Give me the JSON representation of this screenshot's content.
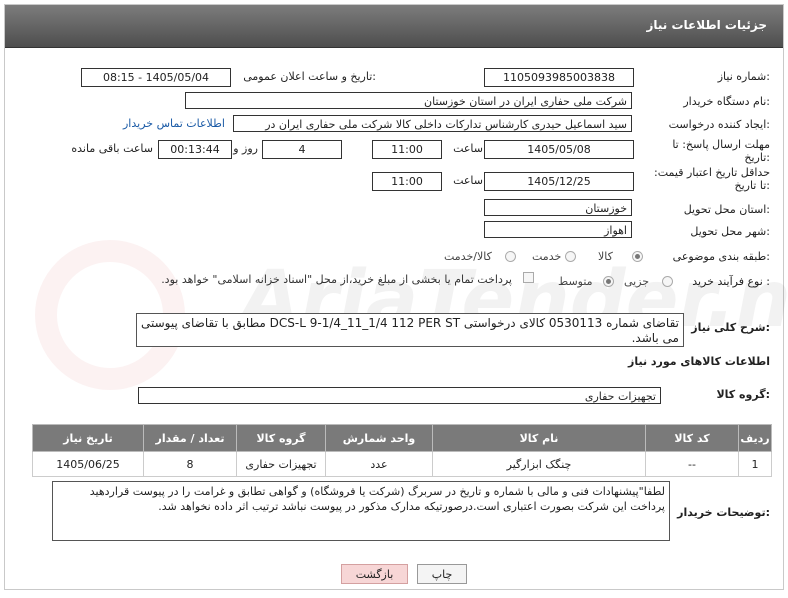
{
  "header": {
    "title": "جزئیات اطلاعات نیاز"
  },
  "need_number": {
    "label": "شماره نیاز:",
    "value": "1105093985003838"
  },
  "announce": {
    "label": "تاریخ و ساعت اعلان عمومی:",
    "value": "1405/05/04 - 08:15"
  },
  "buyer": {
    "label": "نام دستگاه خریدار:",
    "value": "شرکت ملی حفاری ایران در استان خوزستان"
  },
  "creator": {
    "label": "ایجاد کننده درخواست:",
    "value": "سید اسماعیل حیدری کارشناس تدارکات داخلی کالا شرکت ملی حفاری ایران در",
    "contact_link": "اطلاعات تماس خریدار"
  },
  "deadline": {
    "label": "مهلت ارسال پاسخ: تا تاریخ:",
    "date": "1405/05/08",
    "time_label": "ساعت",
    "time": "11:00",
    "days": "4",
    "days_label": "روز و",
    "remaining": "00:13:44",
    "remaining_label": "ساعت باقی مانده"
  },
  "validity": {
    "label": "حداقل تاریخ اعتبار قیمت: تا تاریخ:",
    "date": "1405/12/25",
    "time_label": "ساعت",
    "time": "11:00"
  },
  "province": {
    "label": "استان محل تحویل:",
    "value": "خوزستان"
  },
  "city": {
    "label": "شهر محل تحویل:",
    "value": "اهواز"
  },
  "category": {
    "label": "طبقه بندی موضوعی:",
    "options": [
      "کالا",
      "خدمت",
      "کالا/خدمت"
    ]
  },
  "process": {
    "label": "نوع فرآیند خرید :",
    "options": [
      "جزیی",
      "متوسط"
    ],
    "note": "پرداخت تمام یا بخشی از مبلغ خرید،از محل \"اسناد خزانه اسلامی\" خواهد بود."
  },
  "description": {
    "label": "شرح کلی نیاز:",
    "text": "تقاضای شماره 0530113 کالای درخواستی DCS-L 9-1/4_11_1/4 112 PER ST مطابق با تقاضای پیوستی می باشد."
  },
  "goods_info": {
    "title": "اطلاعات کالاهای مورد نیاز"
  },
  "goods_group": {
    "label": "گروه کالا:",
    "value": "تجهیزات حفاری"
  },
  "table": {
    "headers": [
      "ردیف",
      "کد کالا",
      "نام کالا",
      "واحد شمارش",
      "گروه کالا",
      "تعداد / مقدار",
      "تاریخ نیاز"
    ],
    "rows": [
      [
        "1",
        "--",
        "چنگک ابزارگیر",
        "عدد",
        "تجهیزات حفاری",
        "8",
        "1405/06/25"
      ]
    ]
  },
  "buyer_notes": {
    "label": "توضیحات خریدار:",
    "text": "لطفا\"پیشنهادات فنی و مالی با شماره و تاریخ در سربرگ (شرکت یا فروشگاه) و گواهی تطابق و غرامت را در پیوست قراردهید پرداخت این شرکت بصورت اعتباری است.درصورتیکه مدارک مذکور در پیوست نباشد ترتیب اثر داده نخواهد شد."
  },
  "buttons": {
    "print": "چاپ",
    "back": "بازگشت"
  },
  "watermark": "AriaTender.neT"
}
